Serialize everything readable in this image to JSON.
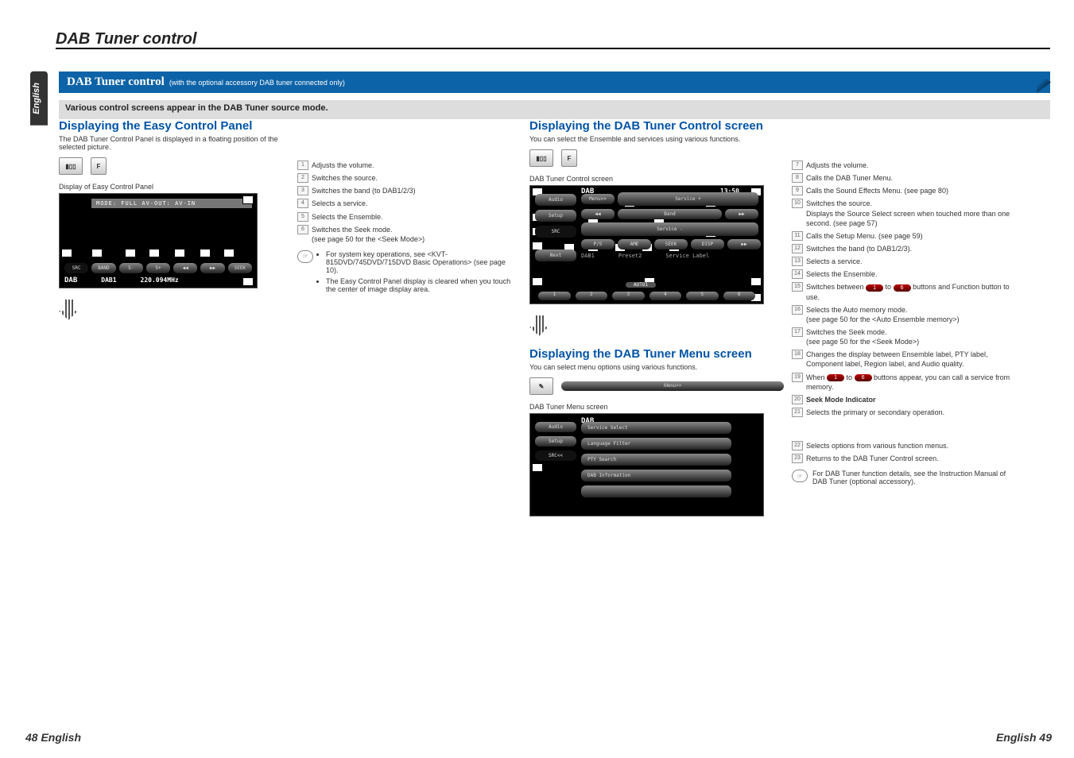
{
  "page_title": "DAB Tuner control",
  "language_tab": "English",
  "blue_bar": {
    "title": "DAB Tuner control",
    "parenthetical": "(with the optional accessory DAB tuner connected only)"
  },
  "content_band": "Various control screens appear in the DAB Tuner source mode.",
  "col1": {
    "heading": "Displaying the Easy Control Panel",
    "desc": "The DAB Tuner Control Panel is displayed in a floating position of the selected picture.",
    "icon_f": "F",
    "caption": "Display of Easy Control Panel",
    "screen": {
      "top_line": "MODE: FULL  AV-OUT: AV-IN",
      "btns": [
        "SRC",
        "BAND",
        "S-",
        "S+",
        "◀◀",
        "▶▶",
        "SEEK"
      ],
      "info": {
        "src_lbl": "DAB",
        "band": "DAB1",
        "freq": "220.094MHz"
      }
    }
  },
  "col2": {
    "items": [
      "Adjusts the volume.",
      "Switches the source.",
      "Switches the band (to DAB1/2/3)",
      "Selects a service.",
      "Selects the Ensemble.",
      "Switches the Seek mode.\n(see page 50 for the <Seek Mode>)"
    ],
    "notes": [
      "For system key operations, see <KVT-815DVD/745DVD/715DVD Basic Operations> (see page 10).",
      "The Easy Control Panel display is cleared when you touch the center of image display area."
    ]
  },
  "col3": {
    "heading": "Displaying the DAB Tuner Control screen",
    "desc": "You can select the Ensemble and services using various functions.",
    "icon_f": "F",
    "caption": "DAB Tuner Control screen",
    "screen": {
      "title": "DAB",
      "clock": "13:50",
      "side_btns": [
        "Audio",
        "Setup",
        "SRC",
        "Next"
      ],
      "row1": [
        "Menu>>",
        "Service +"
      ],
      "row2_left": "◀◀",
      "row2_mid": "Band",
      "row2_right": "▶▶",
      "row3": "Service -",
      "row4_btns": [
        "P/S",
        "AME",
        "SEEK",
        "DISP"
      ],
      "row4_ext": "▶▶",
      "dab_line": {
        "a": "DAB1",
        "b": "Preset2",
        "c": "Service Label"
      },
      "auto_pill": "AUTO1",
      "bottom_btns": [
        "1",
        "2",
        "3",
        "4",
        "5",
        "6"
      ]
    },
    "menu_heading": "Displaying the DAB Tuner Menu screen",
    "menu_desc": "You can select menu options using various functions.",
    "menu_pill": "Menu>>",
    "menu_caption": "DAB Tuner Menu screen",
    "menu_screen": {
      "title": "DAB",
      "side_btns": [
        "Audio",
        "Setup",
        "SRC<<"
      ],
      "items": [
        "Service Select",
        "Language Filter",
        "PTY Search",
        "DAB Information"
      ]
    }
  },
  "col4": {
    "items7_21": [
      "Adjusts the volume.",
      "Calls the DAB Tuner Menu.",
      "Calls the Sound Effects Menu. (see page 80)",
      "Switches the source.\nDisplays the Source Select screen when touched more than one second. (see page 57)",
      "Calls the Setup Menu. (see page 59)",
      "Switches the band (to DAB1/2/3).",
      "Selects a service.",
      "Selects the Ensemble.",
      "Switches between [1] to [6] buttons and Function button to use.",
      "Selects the Auto memory mode.\n(see page 50 for the <Auto Ensemble memory>)",
      "Switches the Seek mode.\n(see page 50 for the <Seek Mode>)",
      "Changes the display between Ensemble label, PTY label, Component label, Region label, and Audio quality.",
      "When [1] to [6] buttons appear, you can call a service from memory.",
      "Seek Mode Indicator",
      "Selects the primary or secondary operation."
    ],
    "items22_23": [
      "Selects options from various function menus.",
      "Returns to the DAB Tuner Control screen."
    ],
    "note": "For DAB Tuner function details, see the Instruction Manual of DAB Tuner (optional accessory)."
  },
  "footer": {
    "left": "48 English",
    "right": "English 49"
  }
}
